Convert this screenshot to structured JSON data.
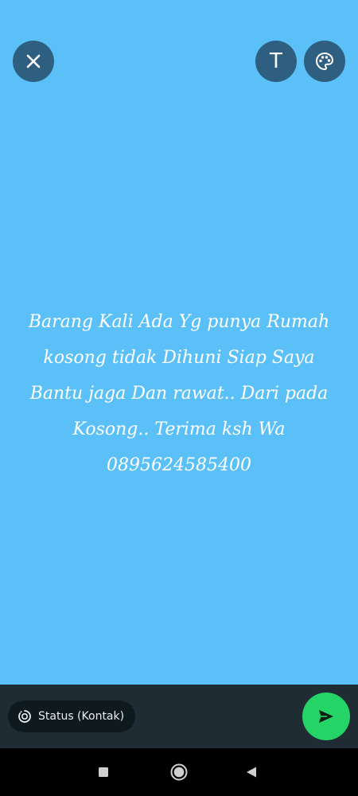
{
  "toolbar": {
    "close_icon": "close-icon",
    "text_tool_label": "T",
    "palette_icon": "palette-icon"
  },
  "status": {
    "text": "Barang Kali Ada Yg punya Rumah kosong tidak Dihuni Siap Saya Bantu jaga Dan rawat.. Dari pada Kosong.. Terima ksh Wa 0895624585400",
    "background_color": "#5BC0F8",
    "text_color": "#FFFFFF"
  },
  "footer": {
    "audience_label": "Status (Kontak)",
    "audience_icon": "status-icon",
    "send_icon": "send-icon",
    "send_color": "#25D366"
  },
  "navigation": {
    "recents_icon": "recents-icon",
    "home_icon": "home-icon",
    "back_icon": "back-icon"
  }
}
